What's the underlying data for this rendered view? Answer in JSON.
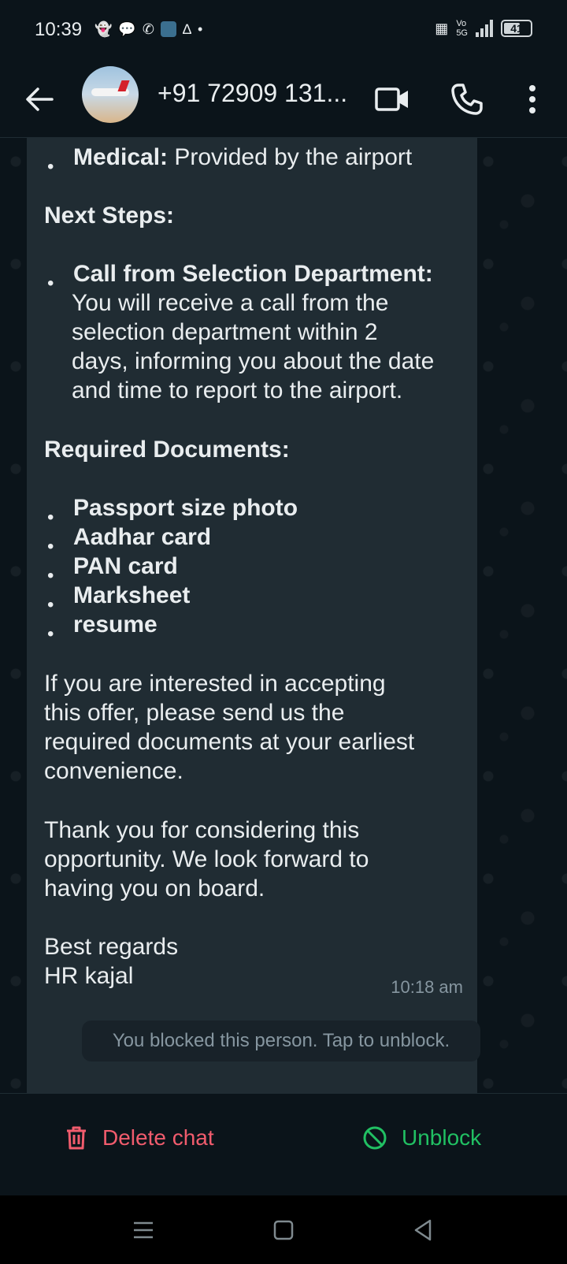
{
  "status_bar": {
    "time": "10:39",
    "battery": "41",
    "network_labels": [
      "Vo",
      "5G"
    ]
  },
  "header": {
    "contact_name": "+91 72909 131..."
  },
  "message": {
    "lines": [
      {
        "bold": "Medical:",
        "text": " Provided by the airport"
      },
      {
        "heading": "Next Steps:"
      },
      {
        "bold": "Call from Selection Department:",
        "text": ""
      },
      {
        "cont": "You will receive a call from the"
      },
      {
        "cont": "selection department within 2"
      },
      {
        "cont": "days, informing you about the date"
      },
      {
        "cont": "and time to report to the airport."
      },
      {
        "heading": "Required Documents:"
      },
      {
        "bold": "Passport size photo"
      },
      {
        "bold": "Aadhar card"
      },
      {
        "bold": "PAN card"
      },
      {
        "bold": "Marksheet"
      },
      {
        "bold": "resume"
      },
      {
        "para": "If you are interested in accepting"
      },
      {
        "para": "this offer, please send us the"
      },
      {
        "para": "required documents at your earliest"
      },
      {
        "para": "convenience."
      },
      {
        "para": "Thank you for considering this"
      },
      {
        "para": "opportunity. We look forward to"
      },
      {
        "para": "having you on board."
      },
      {
        "para": "Best regards"
      },
      {
        "para": "HR kajal"
      }
    ],
    "timestamp": "10:18 am"
  },
  "system_message": "You blocked this person. Tap to unblock.",
  "actions": {
    "delete_label": "Delete chat",
    "unblock_label": "Unblock"
  },
  "colors": {
    "background": "#0b141a",
    "bubble": "#202c33",
    "delete": "#f15c6d",
    "unblock": "#21c063"
  }
}
